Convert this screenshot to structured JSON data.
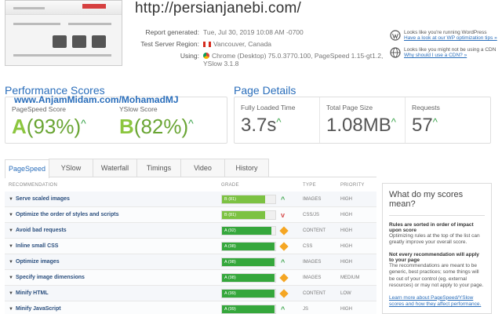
{
  "header": {
    "url": "http://persianjanebi.com/",
    "report_generated_label": "Report generated:",
    "report_generated": "Tue, Jul 30, 2019 10:08 AM -0700",
    "server_label": "Test Server Region:",
    "server": "Vancouver, Canada",
    "using_label": "Using:",
    "using_line1": "Chrome (Desktop) 75.0.3770.100, PageSpeed 1.15-gt1.2,",
    "using_line2": "YSlow 3.1.8"
  },
  "tips": [
    {
      "text": "Looks like you're running WordPress",
      "link": "Have a look at our WP optimization tips »",
      "icon": "wordpress-icon"
    },
    {
      "text": "Looks like you might not be using a CDN",
      "link": "Why should I use a CDN? »",
      "icon": "cdn-globe-icon"
    }
  ],
  "watermark": "www.AnjamMidam.com/MohamadMJ",
  "performance": {
    "title": "Performance Scores",
    "pagespeed_label": "PageSpeed Score",
    "pagespeed_grade": "A",
    "pagespeed_pct": "(93%)",
    "yslow_label": "YSlow Score",
    "yslow_grade": "B",
    "yslow_pct": "(82%)"
  },
  "details": {
    "title": "Page Details",
    "load_label": "Fully Loaded Time",
    "load_value": "3.7s",
    "size_label": "Total Page Size",
    "size_value": "1.08MB",
    "req_label": "Requests",
    "req_value": "57"
  },
  "tabs": [
    "PageSpeed",
    "YSlow",
    "Waterfall",
    "Timings",
    "Video",
    "History"
  ],
  "table": {
    "headers": {
      "rec": "RECOMMENDATION",
      "grade": "GRADE",
      "type": "TYPE",
      "priority": "PRIORITY"
    },
    "rows": [
      {
        "name": "Serve scaled images",
        "grade": "B (81)",
        "score": 81,
        "trend": "up",
        "type": "IMAGES",
        "priority": "HIGH"
      },
      {
        "name": "Optimize the order of styles and scripts",
        "grade": "B (81)",
        "score": 81,
        "trend": "down",
        "type": "CSS/JS",
        "priority": "HIGH"
      },
      {
        "name": "Avoid bad requests",
        "grade": "A (92)",
        "score": 92,
        "trend": "same",
        "type": "CONTENT",
        "priority": "HIGH"
      },
      {
        "name": "Inline small CSS",
        "grade": "A (98)",
        "score": 98,
        "trend": "same",
        "type": "CSS",
        "priority": "HIGH"
      },
      {
        "name": "Optimize images",
        "grade": "A (98)",
        "score": 98,
        "trend": "up",
        "type": "IMAGES",
        "priority": "HIGH"
      },
      {
        "name": "Specify image dimensions",
        "grade": "A (98)",
        "score": 98,
        "trend": "same",
        "type": "IMAGES",
        "priority": "MEDIUM"
      },
      {
        "name": "Minify HTML",
        "grade": "A (99)",
        "score": 99,
        "trend": "same",
        "type": "CONTENT",
        "priority": "LOW"
      },
      {
        "name": "Minify JavaScript",
        "grade": "A (99)",
        "score": 99,
        "trend": "up",
        "type": "JS",
        "priority": "HIGH"
      }
    ]
  },
  "sidebar": {
    "title": "What do my scores mean?",
    "b1": "Rules are sorted in order of impact upon score",
    "p1": "Optimizing rules at the top of the list can greatly improve your overall score.",
    "b2": "Not every recommendation will apply to your page",
    "p2": "The recommendations are meant to be generic, best practices; some things will be out of your control (eg. external resources) or may not apply to your page.",
    "link": "Learn more about PageSpeed/YSlow scores and how they affect performance."
  }
}
